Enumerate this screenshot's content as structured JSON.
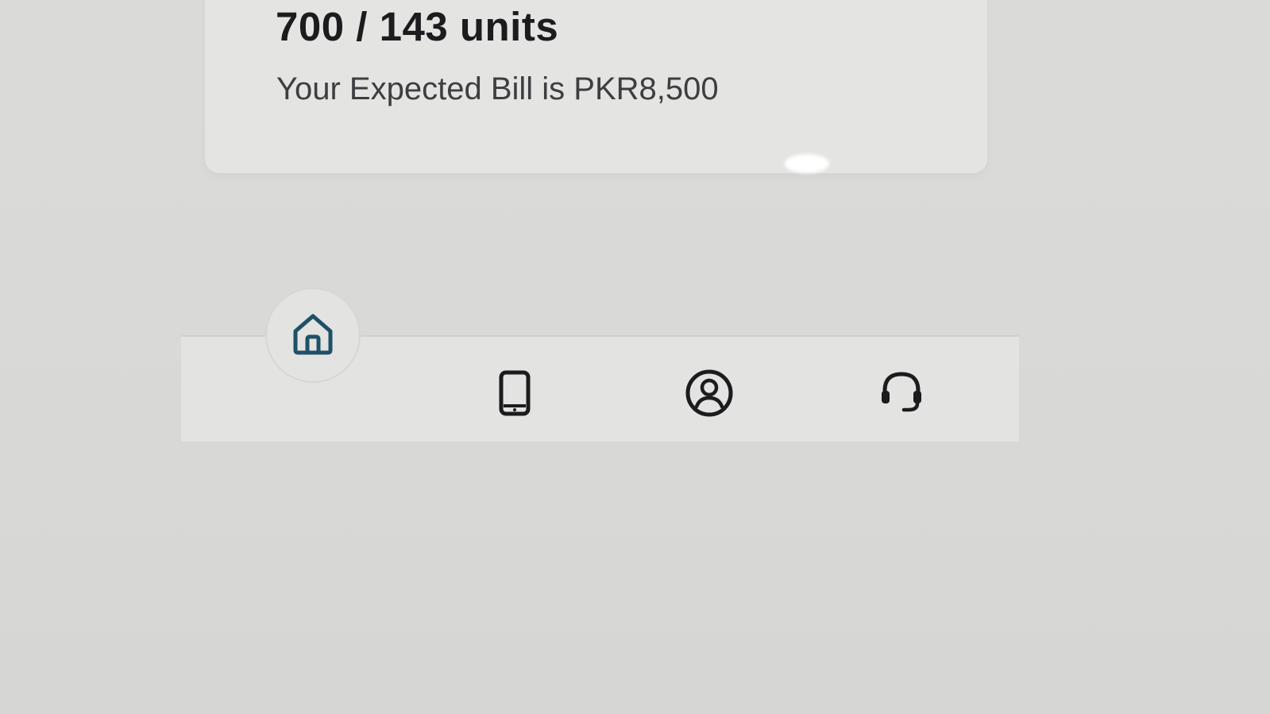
{
  "summary": {
    "usage_text": "700 / 143 units",
    "bill_text": "Your Expected Bill is PKR8,500"
  },
  "bottom_nav": {
    "items": [
      {
        "icon": "home-icon",
        "active": true
      },
      {
        "icon": "mobile-device-icon",
        "active": false
      },
      {
        "icon": "user-profile-icon",
        "active": false
      },
      {
        "icon": "headset-support-icon",
        "active": false
      }
    ]
  },
  "colors": {
    "primary_text": "#1b1c1e",
    "secondary_text": "#3d3e40",
    "active_icon": "#1f5168",
    "inactive_icon": "#1b1c1e",
    "card_background": "#e4e4e2",
    "nav_background": "#e3e3e1"
  }
}
